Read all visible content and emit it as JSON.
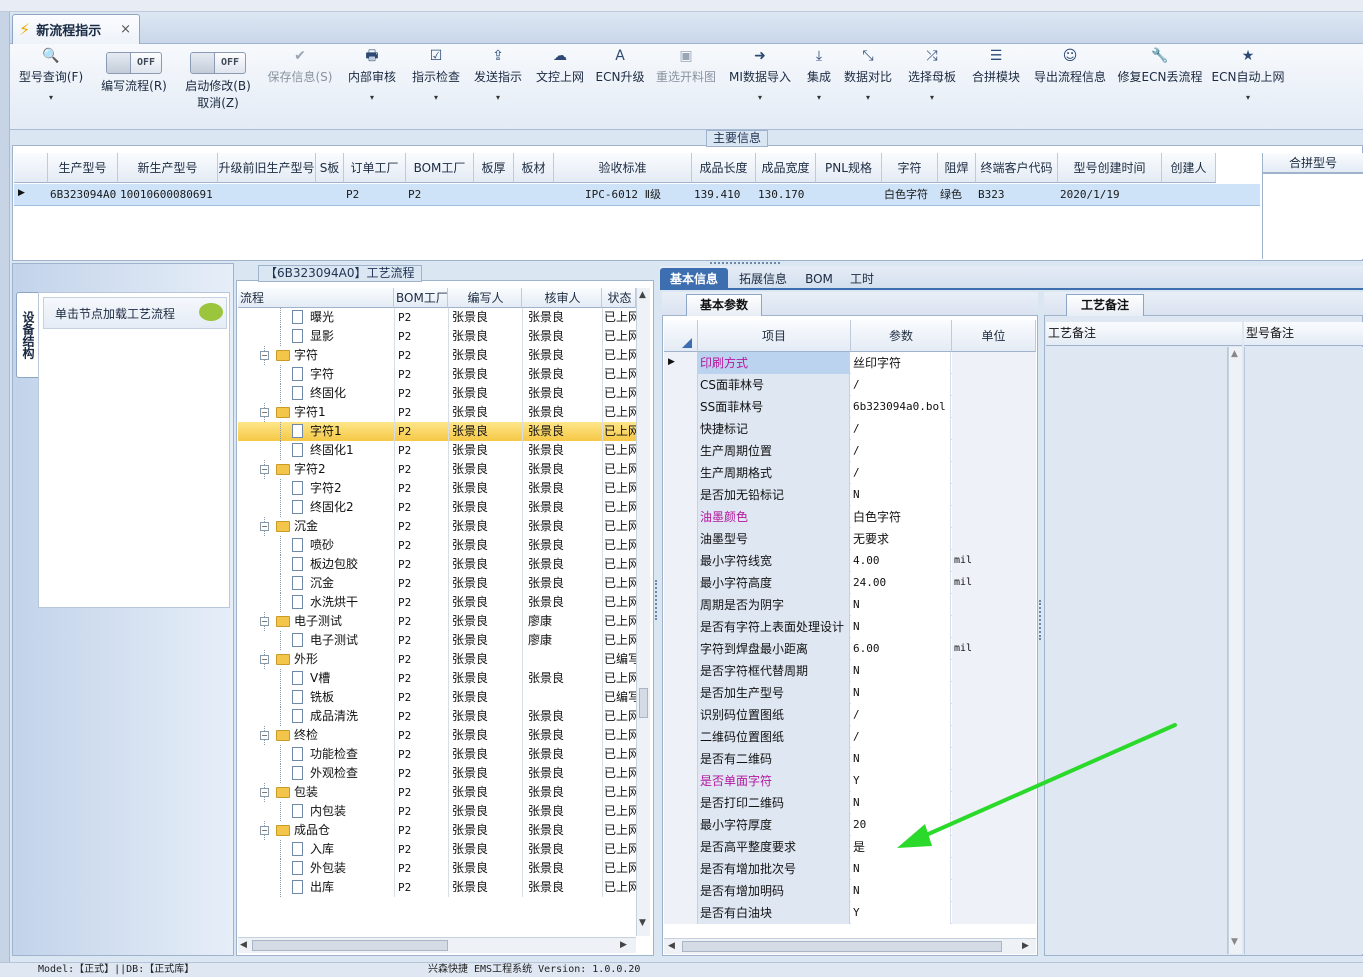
{
  "tab": {
    "title": "新流程指示",
    "close": "×"
  },
  "toolbar": {
    "items": [
      {
        "label": "型号查询(F)",
        "icon": "search-icon",
        "glyph": "🔍"
      },
      {
        "label": "编写流程(R)",
        "toggle": "OFF"
      },
      {
        "label": "启动修改(B)",
        "toggle": "OFF",
        "label2": "取消(Z)"
      },
      {
        "label": "保存信息(S)",
        "icon": "check-icon",
        "glyph": "✔"
      },
      {
        "label": "内部审核",
        "icon": "print-icon",
        "glyph": "🖶"
      },
      {
        "label": "指示检查",
        "icon": "checkbox-icon",
        "glyph": "☑"
      },
      {
        "label": "发送指示",
        "icon": "upload-icon",
        "glyph": "⇪"
      },
      {
        "label": "文控上网",
        "icon": "cloud-upload-icon",
        "glyph": "☁"
      },
      {
        "label": "ECN升级",
        "icon": "font-icon",
        "glyph": "A"
      },
      {
        "label": "重选开料图",
        "icon": "image-icon",
        "glyph": "▣"
      },
      {
        "label": "MI数据导入",
        "icon": "sign-in-icon",
        "glyph": "➜"
      },
      {
        "label": "集成",
        "icon": "download-icon",
        "glyph": "⤓"
      },
      {
        "label": "数据对比",
        "icon": "compress-icon",
        "glyph": "⤡"
      },
      {
        "label": "选择母板",
        "icon": "shuffle-icon",
        "glyph": "⤮"
      },
      {
        "label": "合拼模块",
        "icon": "list-icon",
        "glyph": "☰"
      },
      {
        "label": "导出流程信息",
        "icon": "smile-icon",
        "glyph": "☺"
      },
      {
        "label": "修复ECN丢流程",
        "icon": "wrench-icon",
        "glyph": "🔧"
      },
      {
        "label": "ECN自动上网",
        "icon": "star-icon",
        "glyph": "★"
      }
    ]
  },
  "main_info": {
    "legend": "主要信息",
    "columns": [
      "生产型号",
      "新生产型号",
      "升级前旧生产型号",
      "S板",
      "订单工厂",
      "BOM工厂",
      "板厚",
      "板材",
      "验收标准",
      "成品长度",
      "成品宽度",
      "PNL规格",
      "字符",
      "阻焊",
      "终端客户代码",
      "型号创建时间",
      "创建人"
    ],
    "row": [
      "6B323094A0",
      "10010600080691",
      "",
      "",
      "P2",
      "P2",
      "",
      "",
      "IPC-6012 Ⅱ级",
      "139.410",
      "130.170",
      "",
      "白色字符",
      "绿色",
      "B323",
      "2020/1/19",
      ""
    ],
    "merge_header": "合拼型号"
  },
  "side": {
    "vertical_tab": "设备结构",
    "node_hint": "单击节点加载工艺流程"
  },
  "process": {
    "legend": "【6B323094A0】工艺流程",
    "columns": [
      "流程",
      "BOM工厂",
      "编写人",
      "核审人",
      "状态"
    ],
    "rows": [
      {
        "name": "曝光",
        "level": 2,
        "bom": "P2",
        "writer": "张景良",
        "reviewer": "张景良",
        "status": "已上网"
      },
      {
        "name": "显影",
        "level": 2,
        "bom": "P2",
        "writer": "张景良",
        "reviewer": "张景良",
        "status": "已上网"
      },
      {
        "name": "字符",
        "level": 1,
        "bom": "P2",
        "writer": "张景良",
        "reviewer": "张景良",
        "status": "已上网"
      },
      {
        "name": "字符",
        "level": 2,
        "bom": "P2",
        "writer": "张景良",
        "reviewer": "张景良",
        "status": "已上网"
      },
      {
        "name": "终固化",
        "level": 2,
        "bom": "P2",
        "writer": "张景良",
        "reviewer": "张景良",
        "status": "已上网"
      },
      {
        "name": "字符1",
        "level": 1,
        "bom": "P2",
        "writer": "张景良",
        "reviewer": "张景良",
        "status": "已上网"
      },
      {
        "name": "字符1",
        "level": 2,
        "bom": "P2",
        "writer": "张景良",
        "reviewer": "张景良",
        "status": "已上网",
        "selected": true
      },
      {
        "name": "终固化1",
        "level": 2,
        "bom": "P2",
        "writer": "张景良",
        "reviewer": "张景良",
        "status": "已上网"
      },
      {
        "name": "字符2",
        "level": 1,
        "bom": "P2",
        "writer": "张景良",
        "reviewer": "张景良",
        "status": "已上网"
      },
      {
        "name": "字符2",
        "level": 2,
        "bom": "P2",
        "writer": "张景良",
        "reviewer": "张景良",
        "status": "已上网"
      },
      {
        "name": "终固化2",
        "level": 2,
        "bom": "P2",
        "writer": "张景良",
        "reviewer": "张景良",
        "status": "已上网"
      },
      {
        "name": "沉金",
        "level": 1,
        "bom": "P2",
        "writer": "张景良",
        "reviewer": "张景良",
        "status": "已上网"
      },
      {
        "name": "喷砂",
        "level": 2,
        "bom": "P2",
        "writer": "张景良",
        "reviewer": "张景良",
        "status": "已上网"
      },
      {
        "name": "板边包胶",
        "level": 2,
        "bom": "P2",
        "writer": "张景良",
        "reviewer": "张景良",
        "status": "已上网"
      },
      {
        "name": "沉金",
        "level": 2,
        "bom": "P2",
        "writer": "张景良",
        "reviewer": "张景良",
        "status": "已上网"
      },
      {
        "name": "水洗烘干",
        "level": 2,
        "bom": "P2",
        "writer": "张景良",
        "reviewer": "张景良",
        "status": "已上网"
      },
      {
        "name": "电子测试",
        "level": 1,
        "bom": "P2",
        "writer": "张景良",
        "reviewer": "廖康",
        "status": "已上网"
      },
      {
        "name": "电子测试",
        "level": 2,
        "bom": "P2",
        "writer": "张景良",
        "reviewer": "廖康",
        "status": "已上网"
      },
      {
        "name": "外形",
        "level": 1,
        "bom": "P2",
        "writer": "张景良",
        "reviewer": "",
        "status": "已编写"
      },
      {
        "name": "V槽",
        "level": 2,
        "bom": "P2",
        "writer": "张景良",
        "reviewer": "张景良",
        "status": "已上网"
      },
      {
        "name": "铣板",
        "level": 2,
        "bom": "P2",
        "writer": "张景良",
        "reviewer": "",
        "status": "已编写"
      },
      {
        "name": "成品清洗",
        "level": 2,
        "bom": "P2",
        "writer": "张景良",
        "reviewer": "张景良",
        "status": "已上网"
      },
      {
        "name": "终检",
        "level": 1,
        "bom": "P2",
        "writer": "张景良",
        "reviewer": "张景良",
        "status": "已上网"
      },
      {
        "name": "功能检查",
        "level": 2,
        "bom": "P2",
        "writer": "张景良",
        "reviewer": "张景良",
        "status": "已上网"
      },
      {
        "name": "外观检查",
        "level": 2,
        "bom": "P2",
        "writer": "张景良",
        "reviewer": "张景良",
        "status": "已上网"
      },
      {
        "name": "包装",
        "level": 1,
        "bom": "P2",
        "writer": "张景良",
        "reviewer": "张景良",
        "status": "已上网"
      },
      {
        "name": "内包装",
        "level": 2,
        "bom": "P2",
        "writer": "张景良",
        "reviewer": "张景良",
        "status": "已上网"
      },
      {
        "name": "成品仓",
        "level": 1,
        "bom": "P2",
        "writer": "张景良",
        "reviewer": "张景良",
        "status": "已上网"
      },
      {
        "name": "入库",
        "level": 2,
        "bom": "P2",
        "writer": "张景良",
        "reviewer": "张景良",
        "status": "已上网"
      },
      {
        "name": "外包装",
        "level": 2,
        "bom": "P2",
        "writer": "张景良",
        "reviewer": "张景良",
        "status": "已上网"
      },
      {
        "name": "出库",
        "level": 2,
        "bom": "P2",
        "writer": "张景良",
        "reviewer": "张景良",
        "status": "已上网"
      }
    ]
  },
  "detail_tabs": [
    "基本信息",
    "拓展信息",
    "BOM",
    "工时"
  ],
  "params": {
    "subtab": "基本参数",
    "columns": [
      "项目",
      "参数",
      "单位"
    ],
    "rows": [
      {
        "name": "印刷方式",
        "value": "丝印字符",
        "unit": "",
        "hl": true
      },
      {
        "name": "CS面菲林号",
        "value": "/",
        "unit": ""
      },
      {
        "name": "SS面菲林号",
        "value": "6b323094a0.bol",
        "unit": ""
      },
      {
        "name": "快捷标记",
        "value": "/",
        "unit": ""
      },
      {
        "name": "生产周期位置",
        "value": "/",
        "unit": ""
      },
      {
        "name": "生产周期格式",
        "value": "/",
        "unit": ""
      },
      {
        "name": "是否加无铅标记",
        "value": "N",
        "unit": ""
      },
      {
        "name": "油墨颜色",
        "value": "白色字符",
        "unit": "",
        "hl": true
      },
      {
        "name": "油墨型号",
        "value": "无要求",
        "unit": ""
      },
      {
        "name": "最小字符线宽",
        "value": "4.00",
        "unit": "mil"
      },
      {
        "name": "最小字符高度",
        "value": "24.00",
        "unit": "mil"
      },
      {
        "name": "周期是否为阴字",
        "value": "N",
        "unit": ""
      },
      {
        "name": "是否有字符上表面处理设计",
        "value": "N",
        "unit": ""
      },
      {
        "name": "字符到焊盘最小距离",
        "value": "6.00",
        "unit": "mil"
      },
      {
        "name": "是否字符框代替周期",
        "value": "N",
        "unit": ""
      },
      {
        "name": "是否加生产型号",
        "value": "N",
        "unit": ""
      },
      {
        "name": "识别码位置图纸",
        "value": "/",
        "unit": ""
      },
      {
        "name": "二维码位置图纸",
        "value": "/",
        "unit": ""
      },
      {
        "name": "是否有二维码",
        "value": "N",
        "unit": ""
      },
      {
        "name": "是否单面字符",
        "value": "Y",
        "unit": "",
        "hl": true
      },
      {
        "name": "是否打印二维码",
        "value": "N",
        "unit": ""
      },
      {
        "name": "最小字符厚度",
        "value": "20",
        "unit": ""
      },
      {
        "name": "是否高平整度要求",
        "value": "是",
        "unit": ""
      },
      {
        "name": "是否有增加批次号",
        "value": "N",
        "unit": ""
      },
      {
        "name": "是否有增加明码",
        "value": "N",
        "unit": ""
      },
      {
        "name": "是否有白油块",
        "value": "Y",
        "unit": ""
      }
    ]
  },
  "remarks": {
    "tab": "工艺备注",
    "col1": "工艺备注",
    "col2": "型号备注"
  },
  "status_bar": {
    "left": "Model:【正式】||DB:【正式库】",
    "center": "兴森快捷 EMS工程系统 Version: 1.0.0.20"
  },
  "colors": {
    "selected_row": "#cfe3f8",
    "highlight_text": "#b5179e",
    "arrow": "#2bd92b",
    "tab_active": "#3d6fb0"
  }
}
